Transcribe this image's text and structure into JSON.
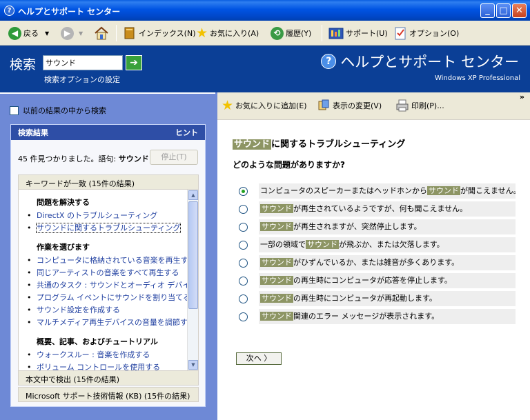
{
  "window": {
    "title": "ヘルプとサポート センター",
    "min_label": "_",
    "max_label": "□",
    "close_label": "✕"
  },
  "toolbar": {
    "back_label": "戻る",
    "index_label": "インデックス(N)",
    "favorites_label": "お気に入り(A)",
    "history_label": "履歴(Y)",
    "support_label": "サポート(U)",
    "options_label": "オプション(O)"
  },
  "header": {
    "search_label": "検索",
    "search_value": "サウンド",
    "search_options": "検索オプションの設定",
    "brand": "ヘルプとサポート センター",
    "edition": "Windows XP Professional"
  },
  "left": {
    "prev_results_label": "以前の結果の中から検索",
    "results_title": "検索結果",
    "hint_label": "ヒント",
    "summary_prefix": "45 件見つかりました。語句:",
    "summary_term": "サウンド",
    "stop_label": "停止(T)",
    "keyword_section": "キーワードが一致 (15件の結果)",
    "groups": [
      {
        "title": "問題を解決する",
        "links": [
          "DirectX のトラブルシューティング",
          "サウンドに関するトラブルシューティング"
        ]
      },
      {
        "title": "作業を選びます",
        "links": [
          "コンピュータに格納されている音楽を再生する",
          "同じアーティストの音楽をすべて再生する",
          "共通のタスク : サウンドとオーディオ デバイス",
          "プログラム イベントにサウンドを割り当てる",
          "サウンド設定を作成する",
          "マルチメディア再生デバイスの音量を調節する"
        ]
      },
      {
        "title": "概要、記事、およびチュートリアル",
        "links": [
          "ウォークスルー : 音楽を作成する",
          "ボリューム コントロールを使用する"
        ]
      }
    ],
    "fulltext_section": "本文中で検出 (15件の結果)",
    "kb_section": "Microsoft サポート技術情報 (KB) (15件の結果)"
  },
  "right": {
    "add_fav_label": "お気に入りに追加(E)",
    "change_view_label": "表示の変更(V)",
    "print_label": "印刷(P)...",
    "chevron": "»",
    "title_highlight": "サウンド",
    "title_rest": "に関するトラブルシューティング",
    "question": "どのような問題がありますか?",
    "options": [
      {
        "pre": "コンピュータのスピーカーまたはヘッドホンから",
        "hl": "サウンド",
        "post": "が聞こえません。",
        "selected": true
      },
      {
        "pre": "",
        "hl": "サウンド",
        "post": "が再生されているようですが、何も聞こえません。",
        "selected": false
      },
      {
        "pre": "",
        "hl": "サウンド",
        "post": "が再生されますが、突然停止します。",
        "selected": false
      },
      {
        "pre": "一部の領域で",
        "hl": "サウンド",
        "post": "が飛ぶか、または欠落します。",
        "selected": false
      },
      {
        "pre": "",
        "hl": "サウンド",
        "post": "がひずんでいるか、または雑音が多くあります。",
        "selected": false
      },
      {
        "pre": "",
        "hl": "サウンド",
        "post": "の再生時にコンピュータが応答を停止します。",
        "selected": false
      },
      {
        "pre": "",
        "hl": "サウンド",
        "post": "の再生時にコンピュータが再起動します。",
        "selected": false
      },
      {
        "pre": "",
        "hl": "サウンド",
        "post": "関連のエラー メッセージが表示されます。",
        "selected": false
      }
    ],
    "next_label": "次へ 〉"
  },
  "colors": {
    "titlebar": "#0054e3",
    "header": "#0b3f96",
    "left_pane": "#6e89d6",
    "highlight": "#8d9564"
  }
}
